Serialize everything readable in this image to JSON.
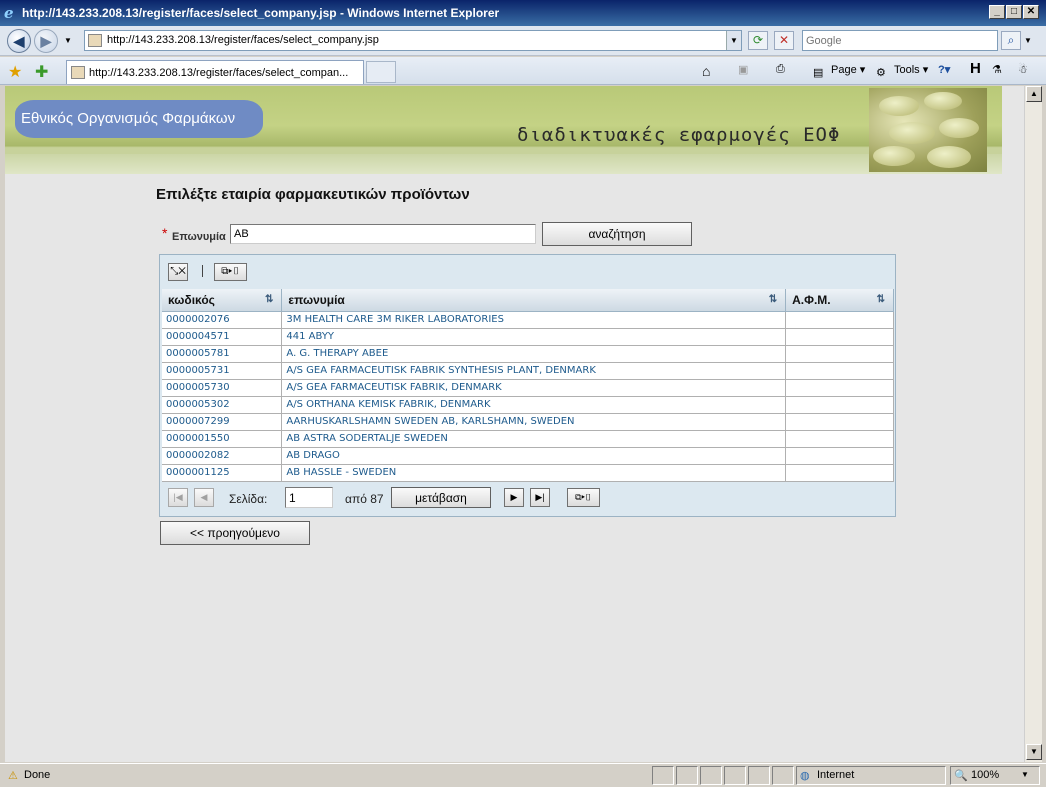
{
  "window": {
    "title": "http://143.233.208.13/register/faces/select_company.jsp - Windows Internet Explorer",
    "min": "_",
    "max": "□",
    "close": "✕"
  },
  "browser": {
    "url": "http://143.233.208.13/register/faces/select_company.jsp",
    "search_placeholder": "Google",
    "tab_label": "http://143.233.208.13/register/faces/select_compan...",
    "page_label": "Page",
    "tools_label": "Tools"
  },
  "banner": {
    "org_name": "Εθνικός Οργανισμός Φαρμάκων",
    "tagline": "διαδικτυακές εφαρμογές ΕΟΦ"
  },
  "page": {
    "title": "Επιλέξτε εταιρία φαρμακευτικών προϊόντων",
    "required_mark": "*",
    "field_label": "Επωνυμία",
    "field_value": "AB",
    "search_button": "αναζήτηση",
    "back_button": "<< προηγούμενο"
  },
  "table": {
    "columns": [
      "κωδικός",
      "επωνυμία",
      "Α.Φ.Μ."
    ],
    "rows": [
      {
        "code": "0000002076",
        "name": "3M HEALTH CARE 3M RIKER LABORATORIES",
        "afm": ""
      },
      {
        "code": "0000004571",
        "name": "441 ABYY",
        "afm": ""
      },
      {
        "code": "0000005781",
        "name": "A. G. THERAPY ABEE",
        "afm": ""
      },
      {
        "code": "0000005731",
        "name": "A/S GEA FARMACEUTISK FABRIK SYNTHESIS PLANT, DENMARK",
        "afm": ""
      },
      {
        "code": "0000005730",
        "name": "A/S GEA FARMACEUTISK FABRIK, DENMARK",
        "afm": ""
      },
      {
        "code": "0000005302",
        "name": "A/S ORTHANA KEMISK FABRIK, DENMARK",
        "afm": ""
      },
      {
        "code": "0000007299",
        "name": "AARHUSKARLSHAMN SWEDEN AB, KARLSHAMN, SWEDEN",
        "afm": ""
      },
      {
        "code": "0000001550",
        "name": "AB ASTRA SODERTALJE SWEDEN",
        "afm": ""
      },
      {
        "code": "0000002082",
        "name": "AB DRAGO",
        "afm": ""
      },
      {
        "code": "0000001125",
        "name": "AB HASSLE - SWEDEN",
        "afm": ""
      }
    ]
  },
  "pager": {
    "page_label": "Σελίδα:",
    "page_value": "1",
    "of_label": "από 87",
    "go_button": "μετάβαση"
  },
  "status": {
    "text": "Done",
    "zone": "Internet",
    "zoom": "100%"
  }
}
